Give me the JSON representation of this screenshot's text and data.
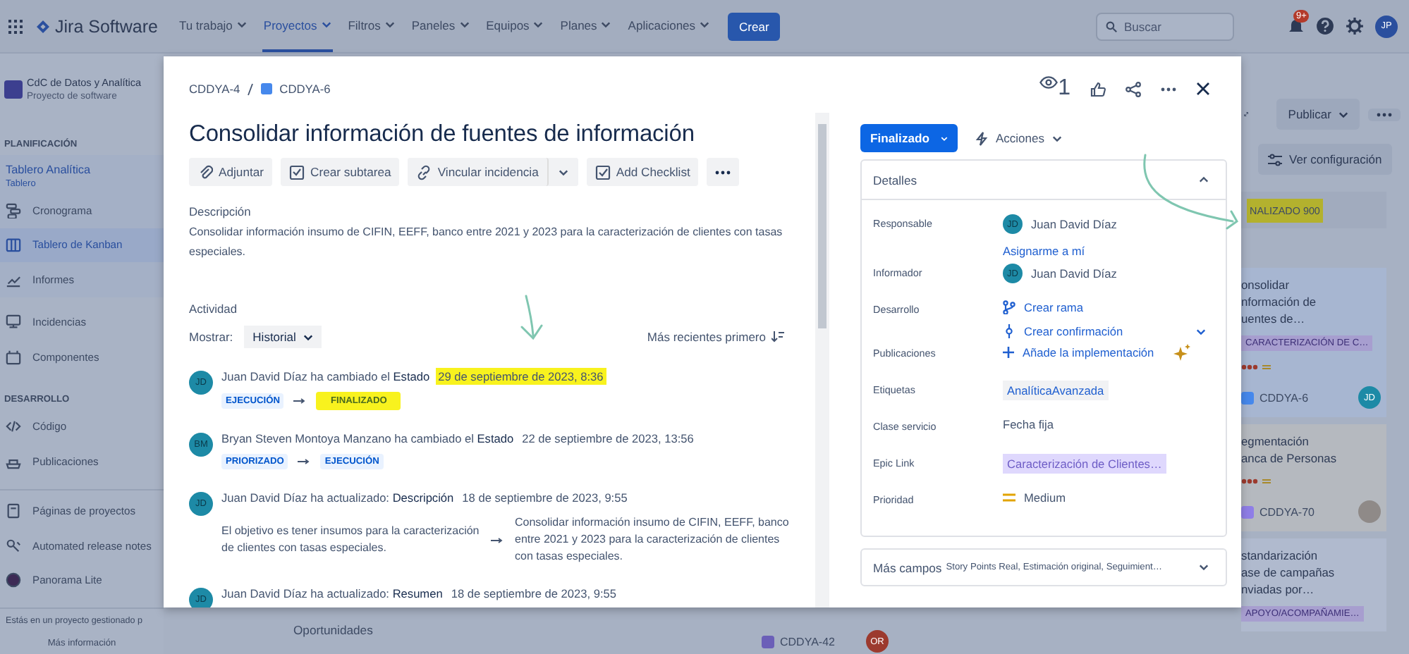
{
  "topbar": {
    "product": "Jira Software",
    "nav": [
      {
        "label": "Tu trabajo",
        "selected": false
      },
      {
        "label": "Proyectos",
        "selected": true
      },
      {
        "label": "Filtros",
        "selected": false
      },
      {
        "label": "Paneles",
        "selected": false
      },
      {
        "label": "Equipos",
        "selected": false
      },
      {
        "label": "Planes",
        "selected": false
      },
      {
        "label": "Aplicaciones",
        "selected": false
      }
    ],
    "create": "Crear",
    "search": {
      "placeholder": "Buscar"
    },
    "notifications": "9+",
    "avatar": "JP"
  },
  "sidebar": {
    "project": {
      "name": "CdC de Datos y Analítica",
      "type": "Proyecto de software"
    },
    "sections": [
      {
        "heading": "PLANIFICACIÓN",
        "board": {
          "name": "Tablero Analítica",
          "type": "Tablero"
        },
        "items": [
          {
            "label": "Cronograma",
            "selected": false
          },
          {
            "label": "Tablero de Kanban",
            "selected": true
          },
          {
            "label": "Informes",
            "selected": false
          }
        ]
      },
      {
        "items": [
          {
            "label": "Incidencias",
            "selected": false
          },
          {
            "label": "Componentes",
            "selected": false
          }
        ]
      },
      {
        "heading": "DESARROLLO",
        "items": [
          {
            "label": "Código",
            "selected": false
          },
          {
            "label": "Publicaciones",
            "selected": false
          }
        ]
      },
      {
        "items": [
          {
            "label": "Páginas de proyectos",
            "selected": false
          },
          {
            "label": "Automated release notes",
            "selected": false
          },
          {
            "label": "Panorama Lite",
            "selected": false
          }
        ]
      }
    ],
    "footer": {
      "text": "Estás en un proyecto gestionado p",
      "link": "Más información"
    }
  },
  "issue": {
    "breadcrumb": [
      "CDDYA-4",
      "CDDYA-6"
    ],
    "watchers": "1",
    "title": "Consolidar información de fuentes de información",
    "toolbar": [
      "Adjuntar",
      "Crear subtarea",
      "Vincular incidencia",
      "Add Checklist"
    ],
    "description": {
      "label": "Descripción",
      "text": "Consolidar información insumo de CIFIN, EEFF, banco entre 2021 y 2023 para la caracterización de clientes con tasas especiales."
    },
    "activity": {
      "label": "Actividad",
      "show_label": "Mostrar:",
      "show_value": "Historial",
      "sort": "Más recientes primero",
      "entries": [
        {
          "avatar": "JD",
          "text": "Juan David Díaz ha cambiado el **Estado**",
          "date": "29 de septiembre de 2023, 8:36",
          "highlighted": true,
          "kind": "status",
          "from": {
            "label": "EJECUCIÓN",
            "kind": "progress",
            "highlighted": false
          },
          "to": {
            "label": "FINALIZADO",
            "kind": "done",
            "highlighted": true
          }
        },
        {
          "avatar": "BM",
          "text": "Bryan Steven Montoya Manzano ha cambiado el **Estado**",
          "date": "22 de septiembre de 2023, 13:56",
          "highlighted": false,
          "kind": "status",
          "from": {
            "label": "PRIORIZADO",
            "kind": "progress",
            "highlighted": false
          },
          "to": {
            "label": "EJECUCIÓN",
            "kind": "progress",
            "highlighted": false
          }
        },
        {
          "avatar": "JD",
          "text": "Juan David Díaz ha actualizado: **Descripción**",
          "date": "18 de septiembre de 2023, 9:55",
          "highlighted": false,
          "kind": "text",
          "old": "El objetivo es tener insumos para la caracterización de clientes con tasas especiales.",
          "new": "Consolidar información insumo de CIFIN, EEFF, banco entre 2021 y 2023 para la caracterización de clientes con tasas especiales."
        },
        {
          "avatar": "JD",
          "text": "Juan David Díaz ha actualizado: **Resumen**",
          "date": "18 de septiembre de 2023, 9:55",
          "highlighted": false,
          "kind": "none"
        }
      ]
    },
    "status": "Finalizado",
    "actions": "Acciones",
    "details": {
      "title": "Detalles",
      "fields": [
        {
          "kind": "person",
          "label": "Responsable",
          "avatar": "JD",
          "value": "Juan David Díaz",
          "link": "Asignarme a mí"
        },
        {
          "kind": "person",
          "label": "Informador",
          "avatar": "JD",
          "value": "Juan David Díaz"
        },
        {
          "kind": "dev",
          "label": "Desarrollo",
          "actions": [
            "Crear rama",
            "Crear confirmación"
          ]
        },
        {
          "kind": "add",
          "label": "Publicaciones",
          "value": "Añade la implementación"
        },
        {
          "kind": "tag",
          "label": "Etiquetas",
          "value": "AnalíticaAvanzada"
        },
        {
          "kind": "text",
          "label": "Clase servicio",
          "value": "Fecha fija"
        },
        {
          "kind": "epic",
          "label": "Epic Link",
          "value": "Caracterización de Clientes…"
        },
        {
          "kind": "priority",
          "label": "Prioridad",
          "value": "Medium"
        }
      ]
    },
    "more_fields": {
      "label": "Más campos",
      "summary": "Story Points Real, Estimación original, Seguimient…"
    }
  },
  "board_right": {
    "publish": "Publicar",
    "settings": "Ver configuración",
    "column": {
      "title": "NALIZADO 900",
      "highlighted": true
    },
    "cards": [
      {
        "title_lines": [
          "onsolidar",
          "nformación de",
          "uentes de…"
        ],
        "epic": "CARACTERIZACIÓN DE C…",
        "key": "CDDYA-6",
        "color": "#4688ec",
        "avatar": {
          "kind": "initials",
          "text": "JD"
        }
      },
      {
        "title_lines": [
          "egmentación",
          "anca de Personas"
        ],
        "key": "CDDYA-70",
        "color": "#8f7ee7",
        "avatar": {
          "kind": "photo"
        }
      },
      {
        "title_lines": [
          "standarización",
          "ase de campañas",
          "nviadas por…"
        ],
        "epic": "APOYO/ACOMPAÑAMIE…"
      }
    ]
  },
  "board_bottom": {
    "text": "Oportunidades",
    "key": "CDDYA-42",
    "avatar": "OR"
  }
}
